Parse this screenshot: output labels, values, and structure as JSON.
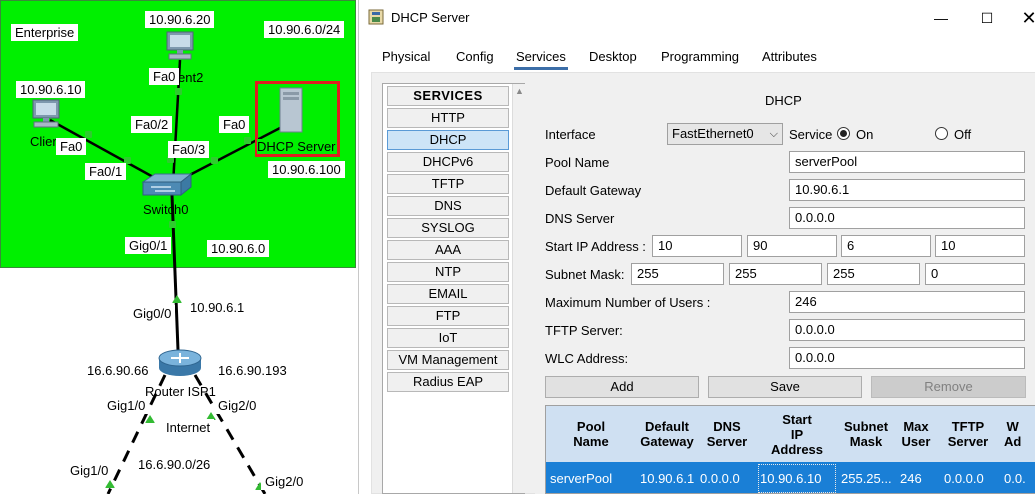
{
  "topology": {
    "labels": {
      "enterprise": "Enterprise",
      "client2_ip": "10.90.6.20",
      "network": "10.90.6.0/24",
      "client1_ip": "10.90.6.10",
      "client1_name": "Clier",
      "client2_name": "ent2",
      "client2_port": "Fa0",
      "client1_port": "Fa0",
      "switch_fa02": "Fa0/2",
      "switch_fa01": "Fa0/1",
      "switch_fa03": "Fa0/3",
      "server_port": "Fa0",
      "server_name": "DHCP Server",
      "server_ip": "10.90.6.100",
      "switch_name": "Switch0",
      "gig01": "Gig0/1",
      "net_addr": "10.90.6.0",
      "gig00": "Gig0/0",
      "router_gw": "10.90.6.1",
      "router_left_ip": "16.6.90.66",
      "router_right_ip": "16.6.90.193",
      "router_name": "Router ISP1",
      "gig10": "Gig1/0",
      "gig20": "Gig2/0",
      "internet": "Internet",
      "internet_net": "16.6.90.0/26",
      "gig10_lower": "Gig1/0",
      "gig20_lower": "Gig2/0"
    }
  },
  "window": {
    "title": "DHCP Server",
    "min_glyph": "—",
    "max_glyph": "☐",
    "close_glyph": "✕",
    "tabs": [
      "Physical",
      "Config",
      "Services",
      "Desktop",
      "Programming",
      "Attributes"
    ],
    "active_tab": "Services"
  },
  "services": {
    "header": "SERVICES",
    "items": [
      "HTTP",
      "DHCP",
      "DHCPv6",
      "TFTP",
      "DNS",
      "SYSLOG",
      "AAA",
      "NTP",
      "EMAIL",
      "FTP",
      "IoT",
      "VM Management",
      "Radius EAP"
    ],
    "selected": "DHCP",
    "scroll_up_glyph": "▲"
  },
  "dhcp": {
    "title": "DHCP",
    "interface_label": "Interface",
    "interface_value": "FastEthernet0",
    "chevron": "⌵",
    "service_label": "Service",
    "on_label": "On",
    "off_label": "Off",
    "service_state": "On",
    "pool_name_label": "Pool Name",
    "pool_name": "serverPool",
    "gateway_label": "Default Gateway",
    "gateway": "10.90.6.1",
    "dns_label": "DNS Server",
    "dns": "0.0.0.0",
    "start_ip_label": "Start IP Address :",
    "start_ip": [
      "10",
      "90",
      "6",
      "10"
    ],
    "mask_label": "Subnet Mask:",
    "mask": [
      "255",
      "255",
      "255",
      "0"
    ],
    "max_users_label": "Maximum Number of Users :",
    "max_users": "246",
    "tftp_label": "TFTP Server:",
    "tftp": "0.0.0.0",
    "wlc_label": "WLC Address:",
    "wlc": "0.0.0.0",
    "buttons": {
      "add": "Add",
      "save": "Save",
      "remove": "Remove"
    },
    "table": {
      "headers": [
        "Pool\nName",
        "Default\nGateway",
        "DNS\nServer",
        "Start\nIP\nAddress",
        "Subnet\nMask",
        "Max\nUser",
        "TFTP\nServer",
        "W\nAd"
      ],
      "row": [
        "serverPool",
        "10.90.6.1",
        "0.0.0.0",
        "10.90.6.10",
        "255.25...",
        "246",
        "0.0.0.0",
        "0.0."
      ]
    }
  },
  "colors": {
    "enterprise_bg": "#00f000",
    "highlight": "#e02020",
    "selected_row": "#1a7fd6",
    "table_header": "#cfe0f2"
  }
}
